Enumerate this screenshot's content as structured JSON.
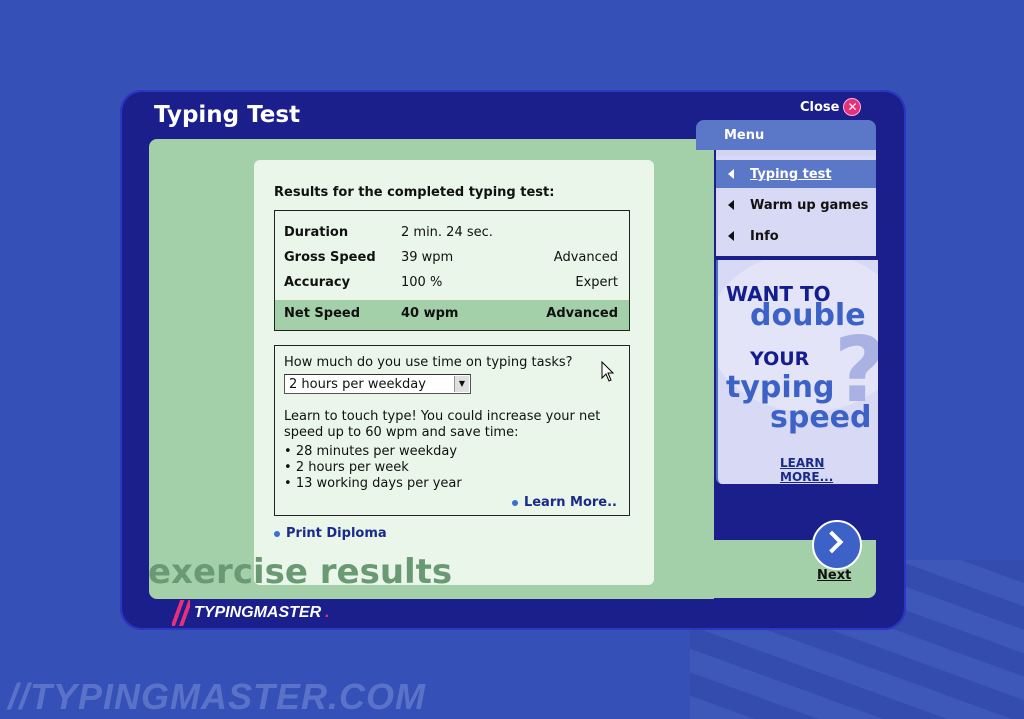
{
  "window": {
    "title": "Typing Test",
    "close_label": "Close"
  },
  "results": {
    "heading": "Results for the completed typing test:",
    "rows": [
      {
        "label": "Duration",
        "value": "2 min. 24 sec.",
        "level": ""
      },
      {
        "label": "Gross Speed",
        "value": "39 wpm",
        "level": "Advanced"
      },
      {
        "label": "Accuracy",
        "value": "100 %",
        "level": "Expert"
      }
    ],
    "net": {
      "label": "Net Speed",
      "value": "40 wpm",
      "level": "Advanced"
    }
  },
  "usage": {
    "question": "How much do you use time on typing tasks?",
    "selected_option": "2 hours per weekday",
    "advice": "Learn to touch type! You could increase your net speed up to 60 wpm and save time:",
    "bullets": [
      "28 minutes per weekday",
      "2 hours per week",
      "13 working days per year"
    ],
    "learn_more": "Learn More.."
  },
  "print_diploma": "Print Diploma",
  "section_label": "exercise results",
  "menu": {
    "title": "Menu",
    "items": [
      {
        "label": "Typing test",
        "active": true
      },
      {
        "label": "Warm up games",
        "active": false
      },
      {
        "label": "Info",
        "active": false
      }
    ]
  },
  "ad": {
    "line1": "WANT TO",
    "line2": "double",
    "line3": "YOUR",
    "line4": "typing",
    "line5": "speed",
    "mark": "?",
    "link": "LEARN MORE..."
  },
  "next_label": "Next",
  "brand": {
    "name": "TYPINGMASTER",
    "suffix": "."
  },
  "watermark": "//TYPINGMASTER.COM",
  "colors": {
    "background": "#3550b6",
    "window": "#1a1f8c",
    "content": "#a3d0a8",
    "panel": "#e9f6e9",
    "accent": "#e8307a"
  }
}
